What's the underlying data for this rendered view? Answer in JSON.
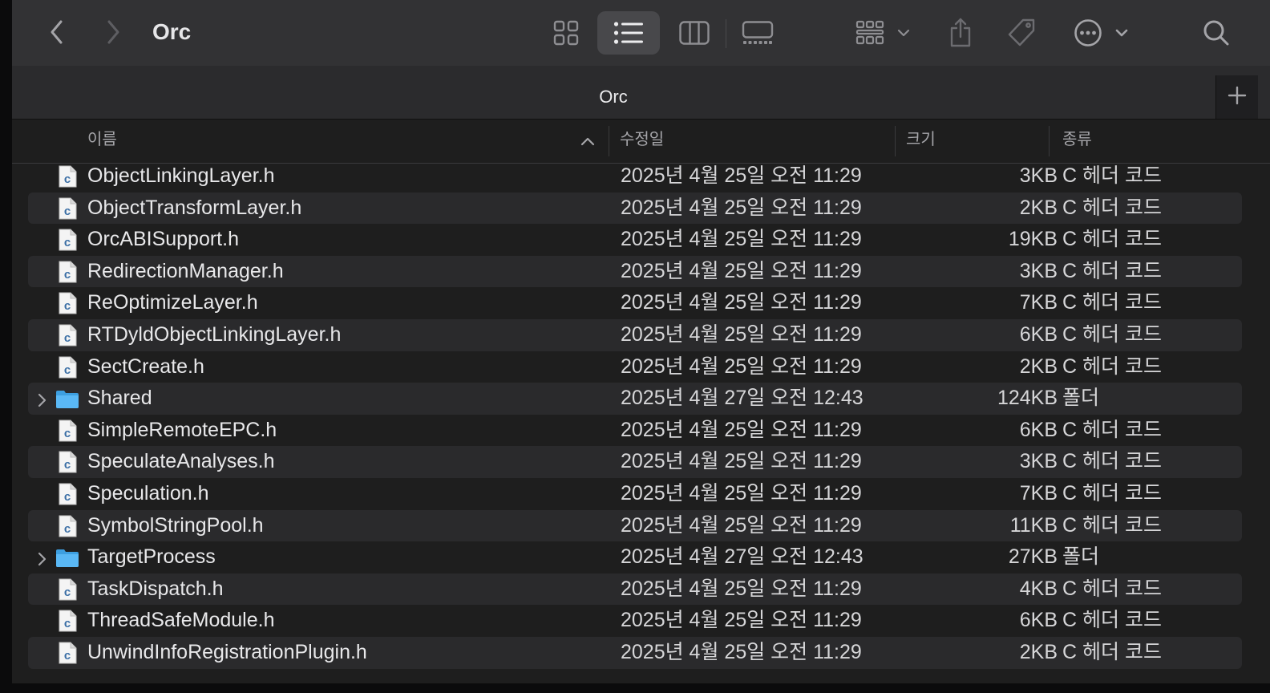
{
  "window": {
    "title": "Orc",
    "tab_title": "Orc"
  },
  "toolbar": {
    "icons": [
      "chevron-left-icon",
      "chevron-right-icon",
      "grid-view-icon",
      "list-view-icon",
      "column-view-icon",
      "gallery-view-icon",
      "group-icon",
      "share-icon",
      "tag-icon",
      "more-icon",
      "search-icon"
    ],
    "selected_view": "list"
  },
  "columns": {
    "name": "이름",
    "date": "수정일",
    "size": "크기",
    "kind": "종류"
  },
  "rows": [
    {
      "name": "ObjectLinkingLayer.h",
      "date": "2025년 4월 25일 오전 11:29",
      "size": "3KB",
      "kind": "C 헤더 코드",
      "type": "file"
    },
    {
      "name": "ObjectTransformLayer.h",
      "date": "2025년 4월 25일 오전 11:29",
      "size": "2KB",
      "kind": "C 헤더 코드",
      "type": "file"
    },
    {
      "name": "OrcABISupport.h",
      "date": "2025년 4월 25일 오전 11:29",
      "size": "19KB",
      "kind": "C 헤더 코드",
      "type": "file"
    },
    {
      "name": "RedirectionManager.h",
      "date": "2025년 4월 25일 오전 11:29",
      "size": "3KB",
      "kind": "C 헤더 코드",
      "type": "file"
    },
    {
      "name": "ReOptimizeLayer.h",
      "date": "2025년 4월 25일 오전 11:29",
      "size": "7KB",
      "kind": "C 헤더 코드",
      "type": "file"
    },
    {
      "name": "RTDyldObjectLinkingLayer.h",
      "date": "2025년 4월 25일 오전 11:29",
      "size": "6KB",
      "kind": "C 헤더 코드",
      "type": "file"
    },
    {
      "name": "SectCreate.h",
      "date": "2025년 4월 25일 오전 11:29",
      "size": "2KB",
      "kind": "C 헤더 코드",
      "type": "file"
    },
    {
      "name": "Shared",
      "date": "2025년 4월 27일 오전 12:43",
      "size": "124KB",
      "kind": "폴더",
      "type": "folder"
    },
    {
      "name": "SimpleRemoteEPC.h",
      "date": "2025년 4월 25일 오전 11:29",
      "size": "6KB",
      "kind": "C 헤더 코드",
      "type": "file"
    },
    {
      "name": "SpeculateAnalyses.h",
      "date": "2025년 4월 25일 오전 11:29",
      "size": "3KB",
      "kind": "C 헤더 코드",
      "type": "file"
    },
    {
      "name": "Speculation.h",
      "date": "2025년 4월 25일 오전 11:29",
      "size": "7KB",
      "kind": "C 헤더 코드",
      "type": "file"
    },
    {
      "name": "SymbolStringPool.h",
      "date": "2025년 4월 25일 오전 11:29",
      "size": "11KB",
      "kind": "C 헤더 코드",
      "type": "file"
    },
    {
      "name": "TargetProcess",
      "date": "2025년 4월 27일 오전 12:43",
      "size": "27KB",
      "kind": "폴더",
      "type": "folder"
    },
    {
      "name": "TaskDispatch.h",
      "date": "2025년 4월 25일 오전 11:29",
      "size": "4KB",
      "kind": "C 헤더 코드",
      "type": "file"
    },
    {
      "name": "ThreadSafeModule.h",
      "date": "2025년 4월 25일 오전 11:29",
      "size": "6KB",
      "kind": "C 헤더 코드",
      "type": "file"
    },
    {
      "name": "UnwindInfoRegistrationPlugin.h",
      "date": "2025년 4월 25일 오전 11:29",
      "size": "2KB",
      "kind": "C 헤더 코드",
      "type": "file"
    }
  ],
  "colors": {
    "toolbar_bg": "#323234",
    "list_bg": "#1e1e1e",
    "row_alt": "#2a2a2c",
    "folder_blue": "#4fb3f2"
  }
}
